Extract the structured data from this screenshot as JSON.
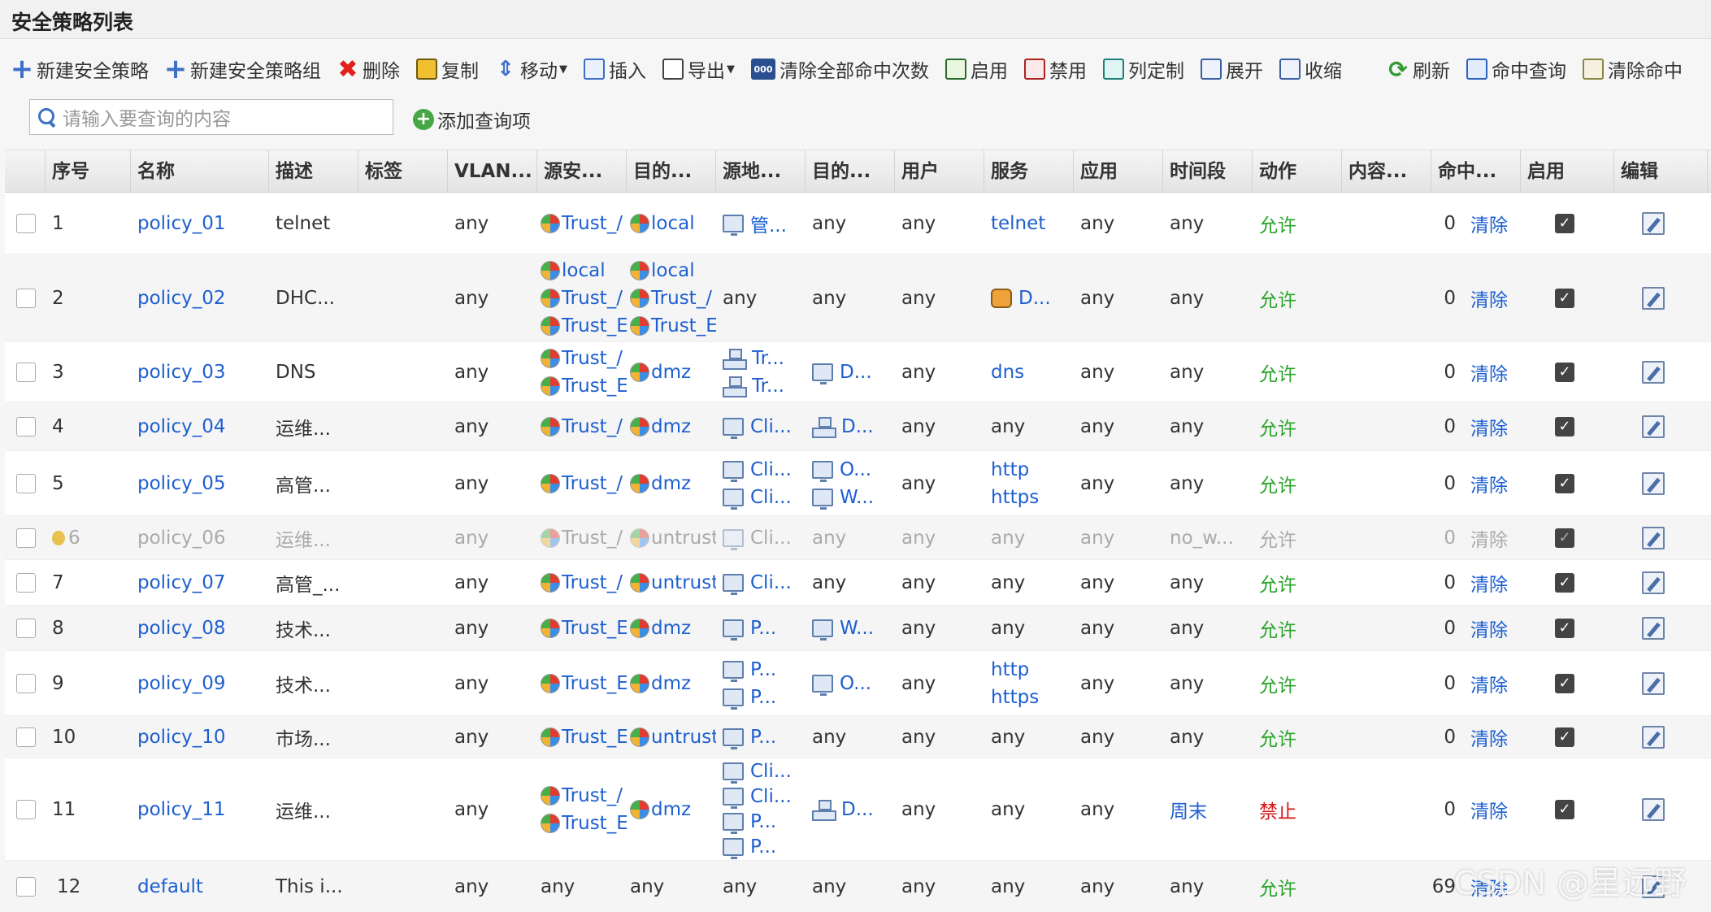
{
  "page": {
    "title": "安全策略列表"
  },
  "toolbar": {
    "new_policy": "新建安全策略",
    "new_group": "新建安全策略组",
    "delete": "删除",
    "copy": "复制",
    "move": "移动",
    "insert": "插入",
    "export": "导出",
    "clear_all_hits": "清除全部命中次数",
    "enable": "启用",
    "disable": "禁用",
    "column_custom": "列定制",
    "expand": "展开",
    "collapse": "收缩",
    "refresh": "刷新",
    "hit_query": "命中查询",
    "clear_hit": "清除命中"
  },
  "search": {
    "placeholder": "请输入要查询的内容",
    "add_query": "添加查询项"
  },
  "columns": {
    "no": "序号",
    "name": "名称",
    "desc": "描述",
    "tag": "标签",
    "vlan": "VLAN...",
    "src_zone": "源安...",
    "dst_zone": "目的...",
    "src_addr": "源地...",
    "dst_addr": "目的...",
    "user": "用户",
    "service": "服务",
    "app": "应用",
    "time": "时间段",
    "action": "动作",
    "content": "内容...",
    "hits": "命中...",
    "enabled": "启用",
    "edit": "编辑"
  },
  "rows": [
    {
      "no": "1",
      "name": "policy_01",
      "desc": "telnet",
      "vlan": "any",
      "src_zone": [
        "Trust_/"
      ],
      "dst_zone": [
        "local"
      ],
      "src_addr": [
        {
          "icon": "pc",
          "text": "管..."
        }
      ],
      "dst_addr": "any",
      "user": "any",
      "service": {
        "list": [
          "telnet"
        ]
      },
      "app": "any",
      "time": "any",
      "action": "允许",
      "hits": "0",
      "clear": "清除"
    },
    {
      "no": "2",
      "name": "policy_02",
      "desc": "DHC...",
      "vlan": "any",
      "src_zone": [
        "local",
        "Trust_/",
        "Trust_E"
      ],
      "dst_zone": [
        "local",
        "Trust_/",
        "Trust_E"
      ],
      "src_addr": [
        {
          "icon": "",
          "text": "any"
        }
      ],
      "dst_addr": "any",
      "user": "any",
      "service": {
        "icon": true,
        "list": [
          "D..."
        ]
      },
      "app": "any",
      "time": "any",
      "action": "允许",
      "hits": "0",
      "clear": "清除"
    },
    {
      "no": "3",
      "name": "policy_03",
      "desc": "DNS",
      "vlan": "any",
      "src_zone": [
        "Trust_/",
        "Trust_E"
      ],
      "dst_zone": [
        "dmz"
      ],
      "src_addr": [
        {
          "icon": "net",
          "text": "Tr..."
        },
        {
          "icon": "net",
          "text": "Tr..."
        }
      ],
      "dst_addr": {
        "icon": "pc",
        "text": "D..."
      },
      "user": "any",
      "service": {
        "list": [
          "dns"
        ]
      },
      "app": "any",
      "time": "any",
      "action": "允许",
      "hits": "0",
      "clear": "清除"
    },
    {
      "no": "4",
      "name": "policy_04",
      "desc": "运维...",
      "vlan": "any",
      "src_zone": [
        "Trust_/"
      ],
      "dst_zone": [
        "dmz"
      ],
      "src_addr": [
        {
          "icon": "pc",
          "text": "Cli..."
        }
      ],
      "dst_addr": {
        "icon": "net",
        "text": "D..."
      },
      "user": "any",
      "service": {
        "plain": "any"
      },
      "app": "any",
      "time": "any",
      "action": "允许",
      "hits": "0",
      "clear": "清除"
    },
    {
      "no": "5",
      "name": "policy_05",
      "desc": "高管...",
      "vlan": "any",
      "src_zone": [
        "Trust_/"
      ],
      "dst_zone": [
        "dmz"
      ],
      "src_addr": [
        {
          "icon": "pc",
          "text": "Cli..."
        },
        {
          "icon": "pc",
          "text": "Cli..."
        }
      ],
      "dst_addr": [
        {
          "icon": "pc",
          "text": "O..."
        },
        {
          "icon": "pc",
          "text": "W..."
        }
      ],
      "user": "any",
      "service": {
        "list": [
          "http",
          "https"
        ]
      },
      "app": "any",
      "time": "any",
      "action": "允许",
      "hits": "0",
      "clear": "清除"
    },
    {
      "no": "6",
      "name": "policy_06",
      "desc": "运维...",
      "vlan": "any",
      "src_zone": [
        "Trust_/"
      ],
      "dst_zone": [
        "untrust"
      ],
      "src_addr": [
        {
          "icon": "pc",
          "text": "Cli..."
        }
      ],
      "dst_addr": "any",
      "user": "any",
      "service": {
        "plain": "any"
      },
      "app": "any",
      "time": "no_w...",
      "action": "允许",
      "hits": "0",
      "clear": "清除",
      "disabled": true
    },
    {
      "no": "7",
      "name": "policy_07",
      "desc": "高管_...",
      "vlan": "any",
      "src_zone": [
        "Trust_/"
      ],
      "dst_zone": [
        "untrust"
      ],
      "src_addr": [
        {
          "icon": "pc",
          "text": "Cli..."
        }
      ],
      "dst_addr": "any",
      "user": "any",
      "service": {
        "plain": "any"
      },
      "app": "any",
      "time": "any",
      "action": "允许",
      "hits": "0",
      "clear": "清除"
    },
    {
      "no": "8",
      "name": "policy_08",
      "desc": "技术...",
      "vlan": "any",
      "src_zone": [
        "Trust_E"
      ],
      "dst_zone": [
        "dmz"
      ],
      "src_addr": [
        {
          "icon": "pc",
          "text": "P..."
        }
      ],
      "dst_addr": {
        "icon": "pc",
        "text": "W..."
      },
      "user": "any",
      "service": {
        "plain": "any"
      },
      "app": "any",
      "time": "any",
      "action": "允许",
      "hits": "0",
      "clear": "清除"
    },
    {
      "no": "9",
      "name": "policy_09",
      "desc": "技术...",
      "vlan": "any",
      "src_zone": [
        "Trust_E"
      ],
      "dst_zone": [
        "dmz"
      ],
      "src_addr": [
        {
          "icon": "pc",
          "text": "P..."
        },
        {
          "icon": "pc",
          "text": "P..."
        }
      ],
      "dst_addr": {
        "icon": "pc",
        "text": "O..."
      },
      "user": "any",
      "service": {
        "list": [
          "http",
          "https"
        ]
      },
      "app": "any",
      "time": "any",
      "action": "允许",
      "hits": "0",
      "clear": "清除"
    },
    {
      "no": "10",
      "name": "policy_10",
      "desc": "市场...",
      "vlan": "any",
      "src_zone": [
        "Trust_E"
      ],
      "dst_zone": [
        "untrust"
      ],
      "src_addr": [
        {
          "icon": "pc",
          "text": "P..."
        }
      ],
      "dst_addr": "any",
      "user": "any",
      "service": {
        "plain": "any"
      },
      "app": "any",
      "time": "any",
      "action": "允许",
      "hits": "0",
      "clear": "清除"
    },
    {
      "no": "11",
      "name": "policy_11",
      "desc": "运维...",
      "vlan": "any",
      "src_zone": [
        "Trust_/",
        "Trust_E"
      ],
      "dst_zone": [
        "dmz"
      ],
      "src_addr": [
        {
          "icon": "pc",
          "text": "Cli..."
        },
        {
          "icon": "pc",
          "text": "Cli..."
        },
        {
          "icon": "pc",
          "text": "P..."
        },
        {
          "icon": "pc",
          "text": "P..."
        }
      ],
      "dst_addr": {
        "icon": "net",
        "text": "D..."
      },
      "user": "any",
      "service": {
        "plain": "any"
      },
      "app": "any",
      "time": "周末",
      "action": "禁止",
      "hits": "0",
      "clear": "清除"
    },
    {
      "no": "12",
      "name": "default",
      "desc": "This i...",
      "vlan": "any",
      "src_zone_plain": "any",
      "dst_zone_plain": "any",
      "src_addr_plain": "any",
      "dst_addr": "any",
      "user": "any",
      "service": {
        "plain": "any"
      },
      "app": "any",
      "time": "any",
      "action": "允许",
      "hits": "69",
      "clear": "清除",
      "is_default": true
    }
  ],
  "watermark": "CSDN @星远野",
  "colors": {
    "link": "#1d5fd0",
    "allow": "#2aa42a",
    "deny": "#d21414",
    "header_bg": "#e4e4e4"
  }
}
